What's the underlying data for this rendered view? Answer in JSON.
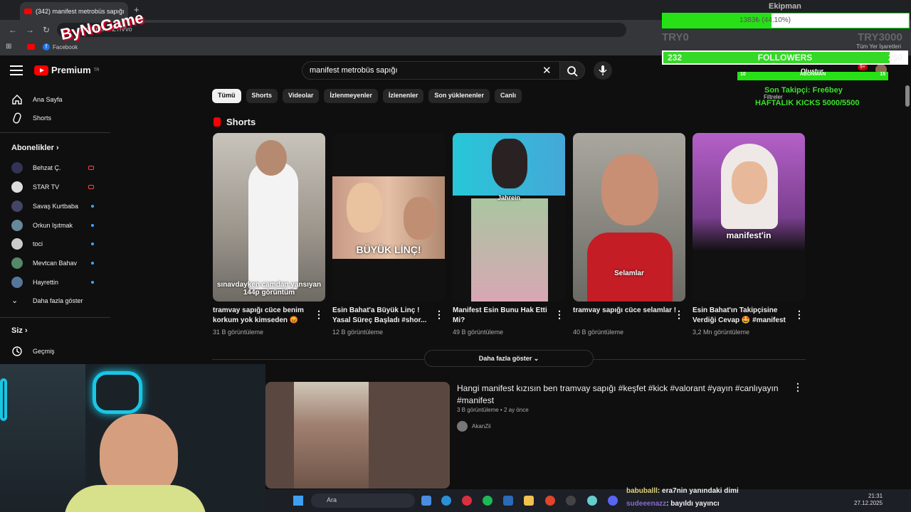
{
  "browser": {
    "tab_title": "(342) manifest metrobüs sapığı",
    "new_tab": "+",
    "url": "m/shorts/...-ZTiVvo",
    "bookmark_fb": "Facebook",
    "bookmarks_right": "Tüm Yer İşaretleri"
  },
  "youtube": {
    "logo": "Premium",
    "logo_sup": "TR",
    "search_value": "manifest metrobüs sapığı",
    "header_right": [
      "Oluştur",
      "Filtreler"
    ],
    "notif_count": "9+",
    "filters": [
      "Tümü",
      "Shorts",
      "Videolar",
      "İzlenmeyenler",
      "İzlenenler",
      "Son yüklenenler",
      "Canlı"
    ]
  },
  "sidebar": {
    "home": "Ana Sayfa",
    "shorts": "Shorts",
    "subs_title": "Abonelikler",
    "subs": [
      "Behzat Ç.",
      "STAR TV",
      "Savaş Kurtbaba",
      "Orkun Işıtmak",
      "toci",
      "Mevtcan Bahav",
      "Hayrettin"
    ],
    "show_more": "Daha fazla göster",
    "you_title": "Siz",
    "history": "Geçmiş"
  },
  "shorts_section": {
    "title": "Shorts",
    "items": [
      {
        "title": "tramvay sapığı cüce benim korkum yok kimseden 😡",
        "views": "31 B görüntüleme",
        "overlay": "sınavdayken camdan yansıyan 144p görüntüm"
      },
      {
        "title": "Esin Bahat'a Büyük Linç ! Yasal Süreç Başladı #shor...",
        "views": "12 B görüntüleme",
        "overlay": "BÜYÜK LİNÇ!"
      },
      {
        "title": "Manifest Esin Bunu Hak Etti Mi?",
        "views": "49 B görüntüleme",
        "overlay": "Jahrein"
      },
      {
        "title": "tramvay sapığı cüce selamlar !",
        "views": "40 B görüntüleme",
        "overlay": "Selamlar"
      },
      {
        "title": "Esin Bahat'ın Takipçisine Verdiği Cevap 🤩 #manifest",
        "views": "3,2 Mn görüntüleme",
        "overlay": "manifest'in"
      }
    ],
    "more": "Daha fazla göster"
  },
  "video": {
    "title": "Hangi manifest kızısın ben tramvay sapığı #keşfet #kick #valorant #yayın #canlıyayın #manifest",
    "meta": "3 B görüntüleme • 2 ay önce",
    "channel": "AkanZii"
  },
  "taskbar": {
    "search": "Ara",
    "time": "21:31",
    "date": "27.12.2025"
  },
  "stream_overlay": {
    "logo": "ByNoGame",
    "team": "Ekipman",
    "goal_text": "1383₺ (44.10%)",
    "goal_fill": 0.441,
    "goal_min": "TRY0",
    "goal_max": "TRY3000",
    "followers_left": "232",
    "followers_label": "FOLLOWERS",
    "followers_right": "250",
    "followers_fill": 0.928,
    "abone_left": "10",
    "abone_label": "ABONMAN",
    "abone_right": "15",
    "last_follower": "Son Takipçi: Fre6bey",
    "weekly": "HAFTALIK KICKS 5000/5500",
    "chat": [
      {
        "user": "babuballl",
        "text": ": era7nin yanındaki dimi"
      },
      {
        "user": "sudeeenazz",
        "text": ": bayıldı yayıncı"
      }
    ]
  },
  "colors": {
    "accent": "#ff0000",
    "overlay_green": "#28e016",
    "background": "#0f0f0f"
  }
}
